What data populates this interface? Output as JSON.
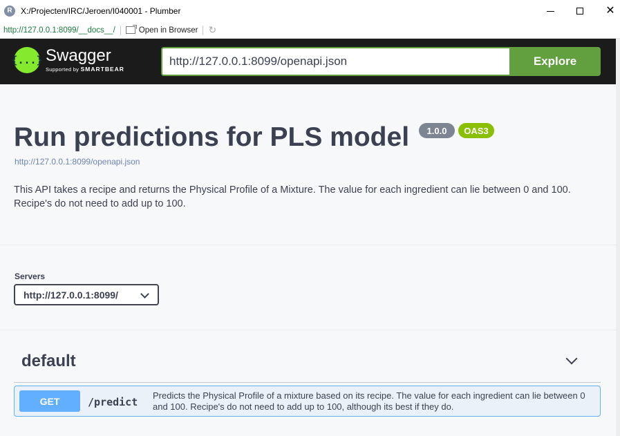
{
  "window": {
    "app_icon": "R",
    "title": "X:/Projecten/IRC/Jeroen/I040001 - Plumber",
    "close_glyph": "✕"
  },
  "addressbar": {
    "url": "http://127.0.0.1:8099/__docs__/",
    "open_in_browser": "Open in Browser",
    "refresh_glyph": "↻"
  },
  "topbar": {
    "logo_mark": "{...}",
    "logo_name": "Swagger",
    "logo_supported": "Supported by",
    "logo_brand": "SMARTBEAR",
    "spec_url_value": "http://127.0.0.1:8099/openapi.json",
    "explore_label": "Explore"
  },
  "info": {
    "title": "Run predictions for PLS model",
    "version_badge": "1.0.0",
    "oas_badge": "OAS3",
    "spec_link": "http://127.0.0.1:8099/openapi.json",
    "description": "This API takes a recipe and returns the Physical Profile of a Mixture. The value for each ingredient can lie between 0 and 100. Recipe's do not need to add up to 100."
  },
  "servers": {
    "label": "Servers",
    "selected": "http://127.0.0.1:8099/"
  },
  "tag": {
    "name": "default"
  },
  "operations": [
    {
      "method": "GET",
      "path": "/predict",
      "summary": "Predicts the Physical Profile of a mixture based on its recipe. The value for each ingredient can lie between 0 and 100. Recipe's do not need to add up to 100, although its best if they do."
    }
  ],
  "colors": {
    "topbar_bg": "#1b1b1b",
    "explore_green": "#62a03f",
    "get_blue": "#61affe",
    "oas_green": "#89bf04",
    "version_grey": "#7d8492",
    "text": "#3b4151"
  }
}
